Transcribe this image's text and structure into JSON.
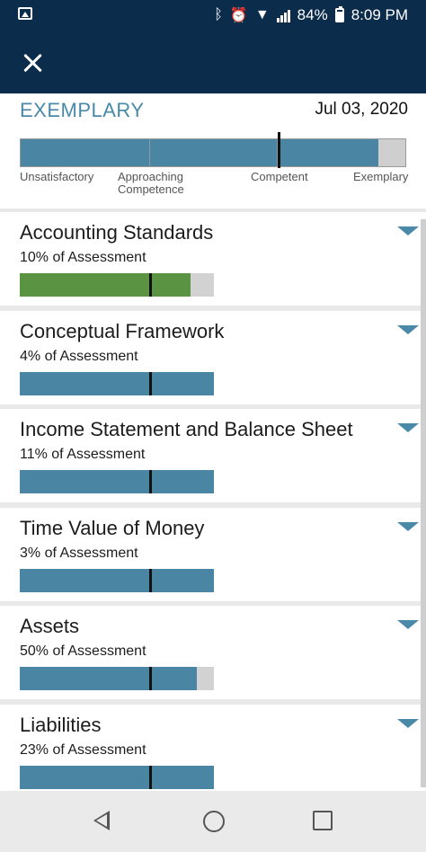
{
  "status_bar": {
    "battery": "84%",
    "time": "8:09 PM",
    "left_icon": "gallery-icon",
    "icons": [
      "bluetooth-icon",
      "alarm-icon",
      "wifi-icon",
      "signal-icon",
      "battery-icon"
    ]
  },
  "app_bar": {
    "close_icon": "close-icon"
  },
  "summary": {
    "rating": "EXEMPLARY",
    "date": "Jul 03, 2020",
    "level_fraction": 0.93,
    "marker_fraction": 0.67,
    "scale_labels": [
      "Unsatisfactory",
      "Approaching Competence",
      "Competent",
      "Exemplary"
    ]
  },
  "topics": [
    {
      "title": "Accounting Standards",
      "share": "10% of Assessment",
      "fill_fraction": 0.88,
      "marker_fraction": 0.67,
      "color": "#5a9342"
    },
    {
      "title": "Conceptual Framework",
      "share": "4% of Assessment",
      "fill_fraction": 1.0,
      "marker_fraction": 0.67,
      "color": "#4a86a3"
    },
    {
      "title": "Income Statement and Balance Sheet",
      "share": "11% of Assessment",
      "fill_fraction": 1.0,
      "marker_fraction": 0.67,
      "color": "#4a86a3"
    },
    {
      "title": "Time Value of Money",
      "share": "3% of Assessment",
      "fill_fraction": 1.0,
      "marker_fraction": 0.67,
      "color": "#4a86a3"
    },
    {
      "title": "Assets",
      "share": "50% of Assessment",
      "fill_fraction": 0.91,
      "marker_fraction": 0.67,
      "color": "#4a86a3"
    },
    {
      "title": "Liabilities",
      "share": "23% of Assessment",
      "fill_fraction": 1.0,
      "marker_fraction": 0.67,
      "color": "#4a86a3"
    }
  ],
  "nav": {
    "icons": [
      "back-icon",
      "home-icon",
      "recent-apps-icon"
    ]
  },
  "colors": {
    "header": "#0b2c4b",
    "accent": "#4a8aa8",
    "bar_blue": "#4a86a3",
    "bar_green": "#5a9342",
    "bar_empty": "#d2d2d2"
  }
}
